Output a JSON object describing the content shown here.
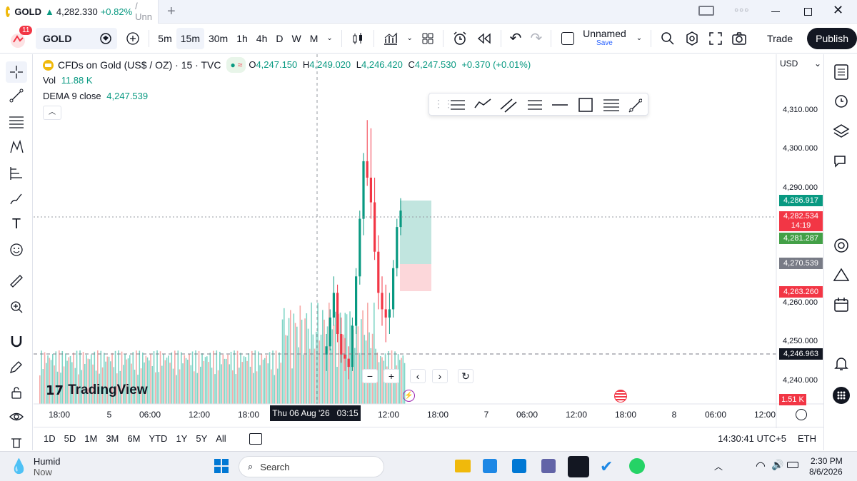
{
  "tab": {
    "symbol": "GOLD",
    "price": "4,282.330",
    "change": "+0.82%",
    "title": "/ Unn",
    "new_tab": "+"
  },
  "window_controls": {
    "more": "○○○"
  },
  "toolbar": {
    "badge": "11",
    "symbol": "GOLD",
    "intervals": [
      "5m",
      "15m",
      "30m",
      "1h",
      "4h",
      "D",
      "W",
      "M"
    ],
    "active_interval": "15m",
    "layout_name": "Unnamed",
    "layout_status": "Save",
    "trade": "Trade",
    "publish": "Publish"
  },
  "legend": {
    "title": "CFDs on Gold (US$ / OZ) · 15 · TVC",
    "o_label": "O",
    "o": "4,247.150",
    "h_label": "H",
    "h": "4,249.020",
    "l_label": "L",
    "l": "4,246.420",
    "c_label": "C",
    "c": "4,247.530",
    "chg": "+0.370 (+0.01%)",
    "vol_label": "Vol",
    "vol": "11.88 K",
    "dema_label": "DEMA 9 close",
    "dema": "4,247.539"
  },
  "currency": "USD",
  "price_axis": {
    "ticks": [
      "4,310.000",
      "4,300.000",
      "4,290.000",
      "4,260.000",
      "4,250.000",
      "4,240.000"
    ],
    "labels": {
      "tp": "4,286.917",
      "current": "4,282.534",
      "countdown": "14:19",
      "entry": "4,281.287",
      "mid": "4,270.539",
      "sl": "4,263.260",
      "cross": "4,246.963",
      "volume": "1.51 K"
    },
    "colors": {
      "tp": "#089981",
      "current": "#f23645",
      "entry": "#43a047",
      "mid": "#787b86",
      "sl": "#f23645",
      "cross": "#131722"
    }
  },
  "time_axis": {
    "ticks": [
      "18:00",
      "5",
      "06:00",
      "12:00",
      "18:00",
      "12:00",
      "18:00",
      "7",
      "06:00",
      "12:00",
      "18:00",
      "8",
      "06:00",
      "12:00"
    ],
    "crosshair": "Thu 06 Aug '26   03:15"
  },
  "watermark": "TradingView",
  "zoom": {
    "minus": "−",
    "plus": "+",
    "left": "‹",
    "right": "›"
  },
  "bottom": {
    "ranges": [
      "1D",
      "5D",
      "1M",
      "3M",
      "6M",
      "YTD",
      "1Y",
      "5Y",
      "All"
    ],
    "clock": "14:30:41 UTC+5",
    "session": "ETH"
  },
  "taskbar": {
    "weather_title": "Humid",
    "weather_sub": "Now",
    "search": "Search",
    "time": "2:30 PM",
    "date": "8/6/2026"
  },
  "chart_data": {
    "type": "candlestick",
    "ylim": [
      4235,
      4320
    ],
    "candles": [
      [
        4247,
        4252,
        4243,
        4249
      ],
      [
        4249,
        4258,
        4248,
        4256
      ],
      [
        4256,
        4266,
        4254,
        4262
      ],
      [
        4262,
        4264,
        4250,
        4252
      ],
      [
        4252,
        4256,
        4245,
        4247
      ],
      [
        4247,
        4251,
        4243,
        4246
      ],
      [
        4246,
        4249,
        4241,
        4244
      ],
      [
        4244,
        4256,
        4243,
        4254
      ],
      [
        4254,
        4268,
        4252,
        4266
      ],
      [
        4266,
        4282,
        4264,
        4280
      ],
      [
        4280,
        4296,
        4276,
        4294
      ],
      [
        4294,
        4304,
        4288,
        4290
      ],
      [
        4290,
        4302,
        4280,
        4284
      ],
      [
        4284,
        4290,
        4270,
        4272
      ],
      [
        4272,
        4276,
        4258,
        4262
      ],
      [
        4262,
        4266,
        4254,
        4258
      ],
      [
        4258,
        4264,
        4250,
        4256
      ],
      [
        4256,
        4262,
        4252,
        4258
      ],
      [
        4258,
        4270,
        4256,
        4268
      ],
      [
        4268,
        4280,
        4266,
        4278
      ],
      [
        4278,
        4285,
        4276,
        4282
      ]
    ]
  }
}
